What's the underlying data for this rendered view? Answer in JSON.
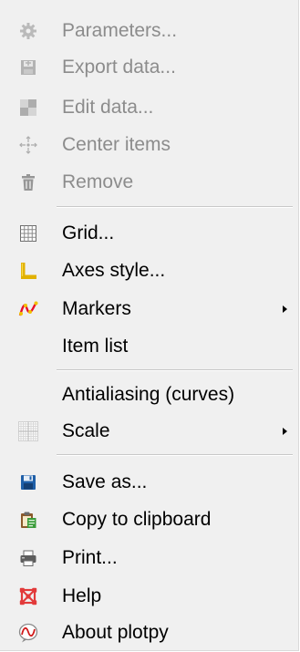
{
  "menu": {
    "items": [
      {
        "label": "Parameters...",
        "icon": "gear-icon",
        "enabled": false
      },
      {
        "label": "Export data...",
        "icon": "export-data-icon",
        "enabled": false
      },
      {
        "label": "Edit data...",
        "icon": "edit-data-icon",
        "enabled": false
      },
      {
        "label": "Center items",
        "icon": "center-items-icon",
        "enabled": false
      },
      {
        "label": "Remove",
        "icon": "trash-icon",
        "enabled": false
      },
      {
        "label": "Grid...",
        "icon": "grid-icon",
        "enabled": true
      },
      {
        "label": "Axes style...",
        "icon": "axes-icon",
        "enabled": true
      },
      {
        "label": "Markers",
        "icon": "markers-icon",
        "enabled": true,
        "submenu": true
      },
      {
        "label": "Item list",
        "icon": "",
        "enabled": true
      },
      {
        "label": "Antialiasing (curves)",
        "icon": "",
        "enabled": true
      },
      {
        "label": "Scale",
        "icon": "scale-icon",
        "enabled": true,
        "submenu": true
      },
      {
        "label": "Save as...",
        "icon": "floppy-disk-icon",
        "enabled": true
      },
      {
        "label": "Copy to clipboard",
        "icon": "clipboard-icon",
        "enabled": true
      },
      {
        "label": "Print...",
        "icon": "printer-icon",
        "enabled": true
      },
      {
        "label": "Help",
        "icon": "help-icon",
        "enabled": true
      },
      {
        "label": "About plotpy",
        "icon": "plotpy-logo-icon",
        "enabled": true
      }
    ]
  }
}
